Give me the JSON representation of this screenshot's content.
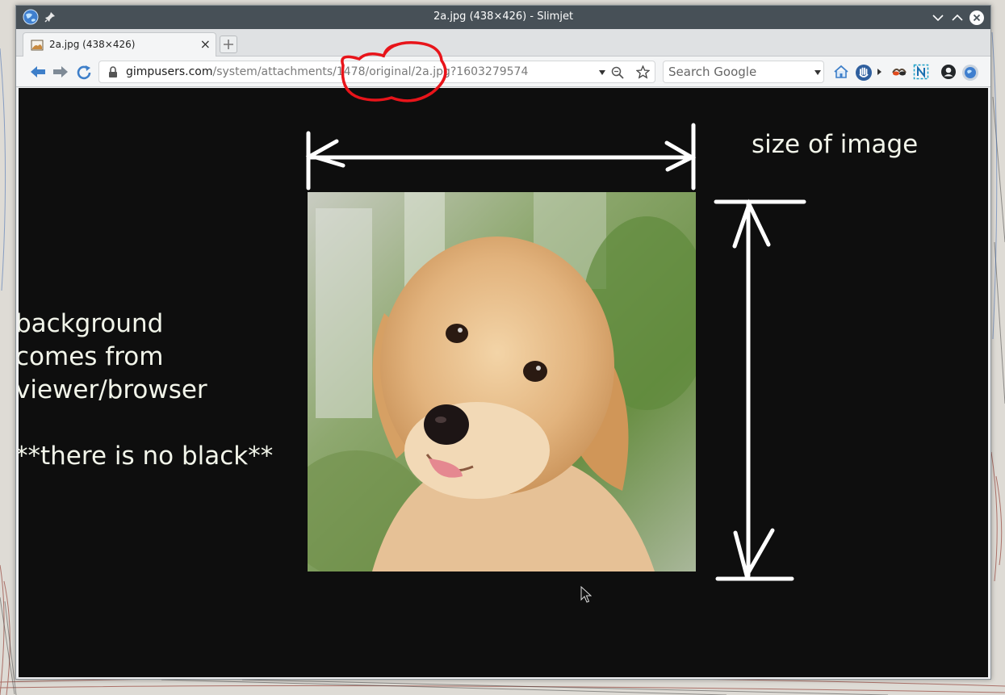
{
  "window": {
    "title": "2a.jpg (438×426) - Slimjet"
  },
  "tabs": [
    {
      "label": "2a.jpg (438×426)",
      "close": "×"
    }
  ],
  "toolbar": {
    "url_host": "gimpusers.com",
    "url_path": "/system/attachments/1478/original/2a.jpg?1603279574",
    "search_placeholder": "Search Google"
  },
  "content": {
    "left_note": "background\ncomes from\nviewer/browser\n\n**there is no black**",
    "size_note": "size of image"
  },
  "colors": {
    "titlebar": "#475057",
    "content_background": "#0e0e0e",
    "annotation_white": "#ffffff",
    "annotation_red": "#e8141a"
  },
  "icons": {
    "app": "globe-icon",
    "pin": "pin-icon",
    "minimize": "chevron-down-icon",
    "maximize": "chevron-up-icon",
    "close": "close-icon",
    "back": "back-arrow-icon",
    "forward": "forward-arrow-icon",
    "reload": "reload-icon",
    "lock": "lock-icon",
    "zoom": "zoom-icon",
    "bookmark": "star-icon",
    "home": "home-icon",
    "account": "account-icon"
  }
}
